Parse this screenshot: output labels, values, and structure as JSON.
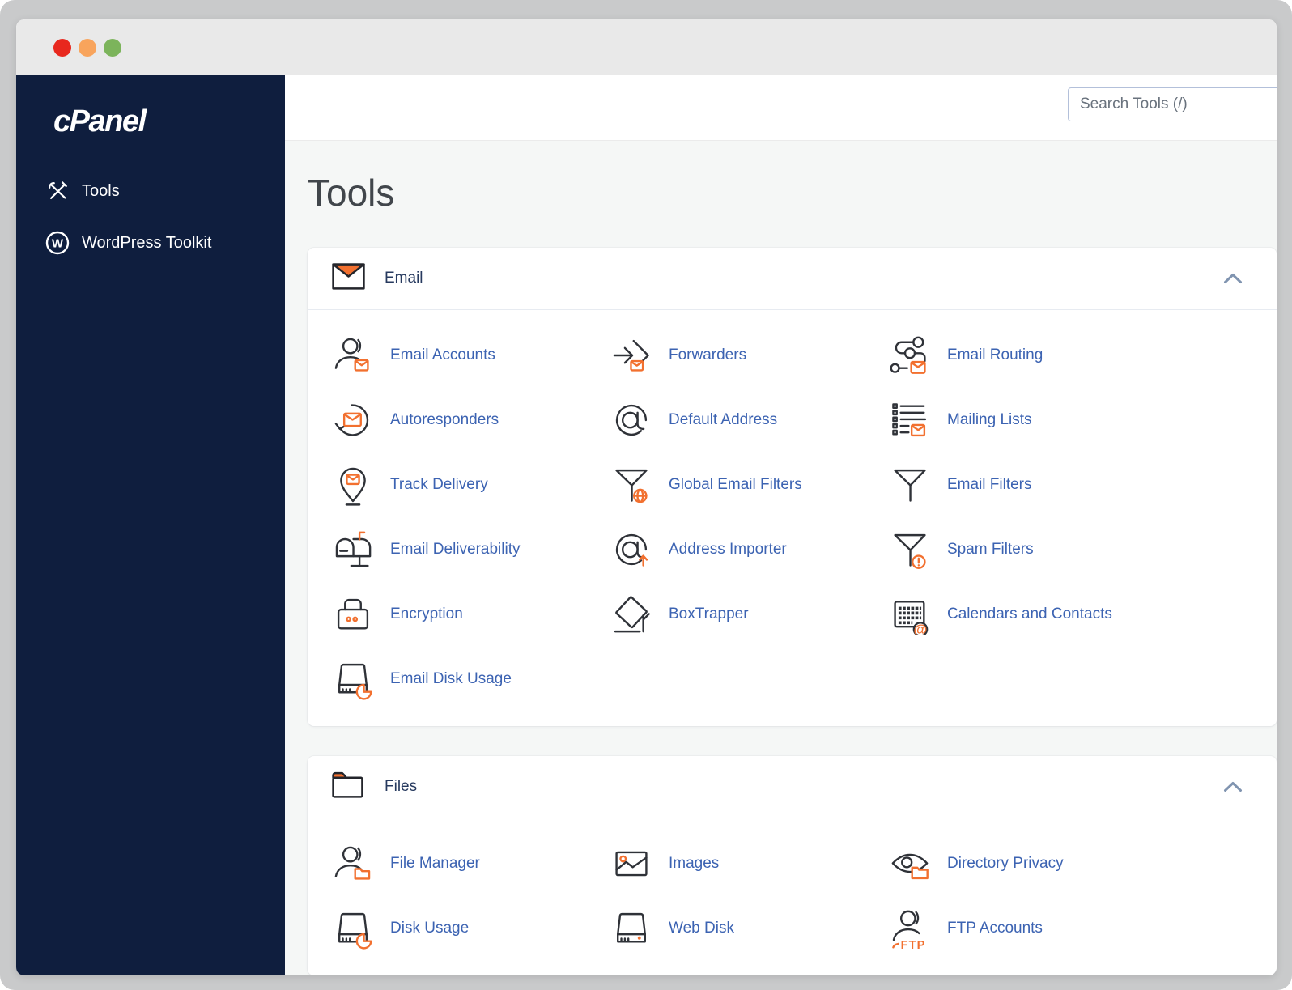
{
  "window": {
    "traffic_lights": {
      "red": "#e8281e",
      "yellow": "#f8a45c",
      "green": "#7cb45b"
    }
  },
  "sidebar": {
    "logo_text": "cPanel",
    "items": [
      {
        "label": "Tools",
        "icon": "tools-icon"
      },
      {
        "label": "WordPress Toolkit",
        "icon": "wordpress-icon"
      }
    ]
  },
  "header": {
    "search": {
      "placeholder": "Search Tools (/)"
    }
  },
  "page": {
    "title": "Tools"
  },
  "sections": [
    {
      "title": "Email",
      "icon": "envelope-icon",
      "collapse_icon": "chevron-up-icon",
      "items": [
        {
          "label": "Email Accounts",
          "icon": "email-accounts-icon"
        },
        {
          "label": "Forwarders",
          "icon": "forwarders-icon"
        },
        {
          "label": "Email Routing",
          "icon": "email-routing-icon"
        },
        {
          "label": "Autoresponders",
          "icon": "autoresponders-icon"
        },
        {
          "label": "Default Address",
          "icon": "default-address-icon"
        },
        {
          "label": "Mailing Lists",
          "icon": "mailing-lists-icon"
        },
        {
          "label": "Track Delivery",
          "icon": "track-delivery-icon"
        },
        {
          "label": "Global Email Filters",
          "icon": "global-email-filters-icon"
        },
        {
          "label": "Email Filters",
          "icon": "email-filters-icon"
        },
        {
          "label": "Email Deliverability",
          "icon": "email-deliverability-icon"
        },
        {
          "label": "Address Importer",
          "icon": "address-importer-icon"
        },
        {
          "label": "Spam Filters",
          "icon": "spam-filters-icon"
        },
        {
          "label": "Encryption",
          "icon": "encryption-icon"
        },
        {
          "label": "BoxTrapper",
          "icon": "boxtrapper-icon"
        },
        {
          "label": "Calendars and Contacts",
          "icon": "calendars-contacts-icon"
        },
        {
          "label": "Email Disk Usage",
          "icon": "email-disk-usage-icon"
        }
      ]
    },
    {
      "title": "Files",
      "icon": "folder-icon",
      "collapse_icon": "chevron-up-icon",
      "items": [
        {
          "label": "File Manager",
          "icon": "file-manager-icon"
        },
        {
          "label": "Images",
          "icon": "images-icon"
        },
        {
          "label": "Directory Privacy",
          "icon": "directory-privacy-icon"
        },
        {
          "label": "Disk Usage",
          "icon": "disk-usage-icon"
        },
        {
          "label": "Web Disk",
          "icon": "web-disk-icon"
        },
        {
          "label": "FTP Accounts",
          "icon": "ftp-accounts-icon"
        }
      ]
    }
  ],
  "colors": {
    "accent_orange": "#f2702f",
    "link_blue": "#3c63b2",
    "sidebar_navy": "#0f1e3e",
    "titlebar_gray": "#e9e9e9",
    "content_bg": "#f5f7f6"
  }
}
